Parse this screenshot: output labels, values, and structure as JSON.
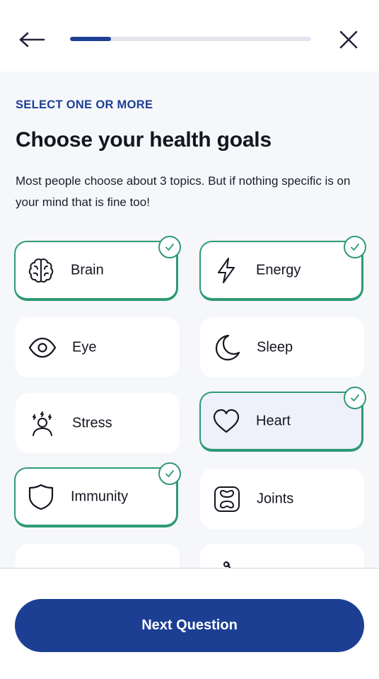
{
  "header": {
    "back_icon": "arrow-left-icon",
    "close_icon": "close-icon",
    "progress_fraction": 0.17
  },
  "question": {
    "eyebrow": "SELECT ONE OR MORE",
    "title": "Choose your health goals",
    "subtitle": "Most people choose about 3 topics. But if nothing specific is on your mind that is fine too!"
  },
  "options": [
    {
      "label": "Brain",
      "icon": "brain-icon",
      "selected": true
    },
    {
      "label": "Energy",
      "icon": "lightning-icon",
      "selected": true
    },
    {
      "label": "Eye",
      "icon": "eye-icon",
      "selected": false
    },
    {
      "label": "Sleep",
      "icon": "moon-icon",
      "selected": false
    },
    {
      "label": "Stress",
      "icon": "stressed-person-icon",
      "selected": false
    },
    {
      "label": "Heart",
      "icon": "heart-icon",
      "selected": true
    },
    {
      "label": "Immunity",
      "icon": "shield-icon",
      "selected": true
    },
    {
      "label": "Joints",
      "icon": "joints-icon",
      "selected": false
    }
  ],
  "footer": {
    "next_label": "Next Question"
  },
  "colors": {
    "primary": "#1c3f94",
    "selected_border": "#2e9a73",
    "background": "#f6f7fb",
    "progress_track": "#e3e4ee"
  }
}
